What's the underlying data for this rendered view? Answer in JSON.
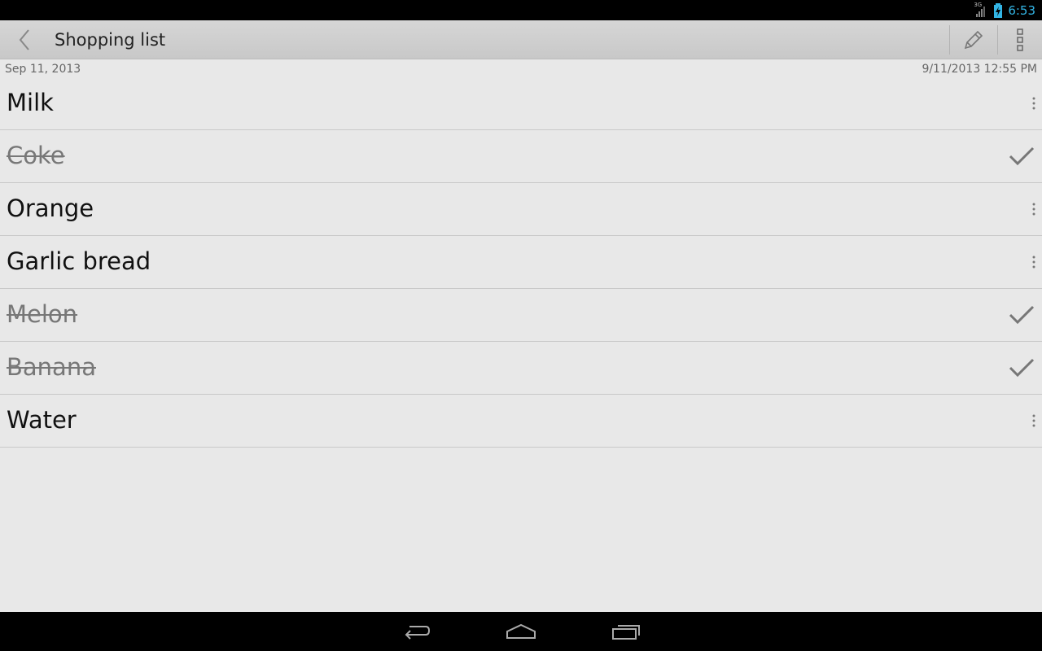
{
  "status_bar": {
    "network_label": "3G",
    "time": "6:53",
    "time_color": "#33b5e5"
  },
  "action_bar": {
    "back_icon": "chevron-left-icon",
    "title": "Shopping list",
    "edit_icon": "pencil-icon",
    "overflow_icon": "overflow-vertical-icon"
  },
  "meta": {
    "date": "Sep 11, 2013",
    "modified": "9/11/2013 12:55 PM"
  },
  "items": [
    {
      "label": "Milk",
      "checked": false
    },
    {
      "label": "Coke",
      "checked": true
    },
    {
      "label": "Orange",
      "checked": false
    },
    {
      "label": "Garlic bread",
      "checked": false
    },
    {
      "label": "Melon",
      "checked": true
    },
    {
      "label": "Banana",
      "checked": true
    },
    {
      "label": "Water",
      "checked": false
    }
  ],
  "nav_bar": {
    "back_icon": "nav-back-icon",
    "home_icon": "nav-home-icon",
    "recents_icon": "nav-recents-icon"
  }
}
